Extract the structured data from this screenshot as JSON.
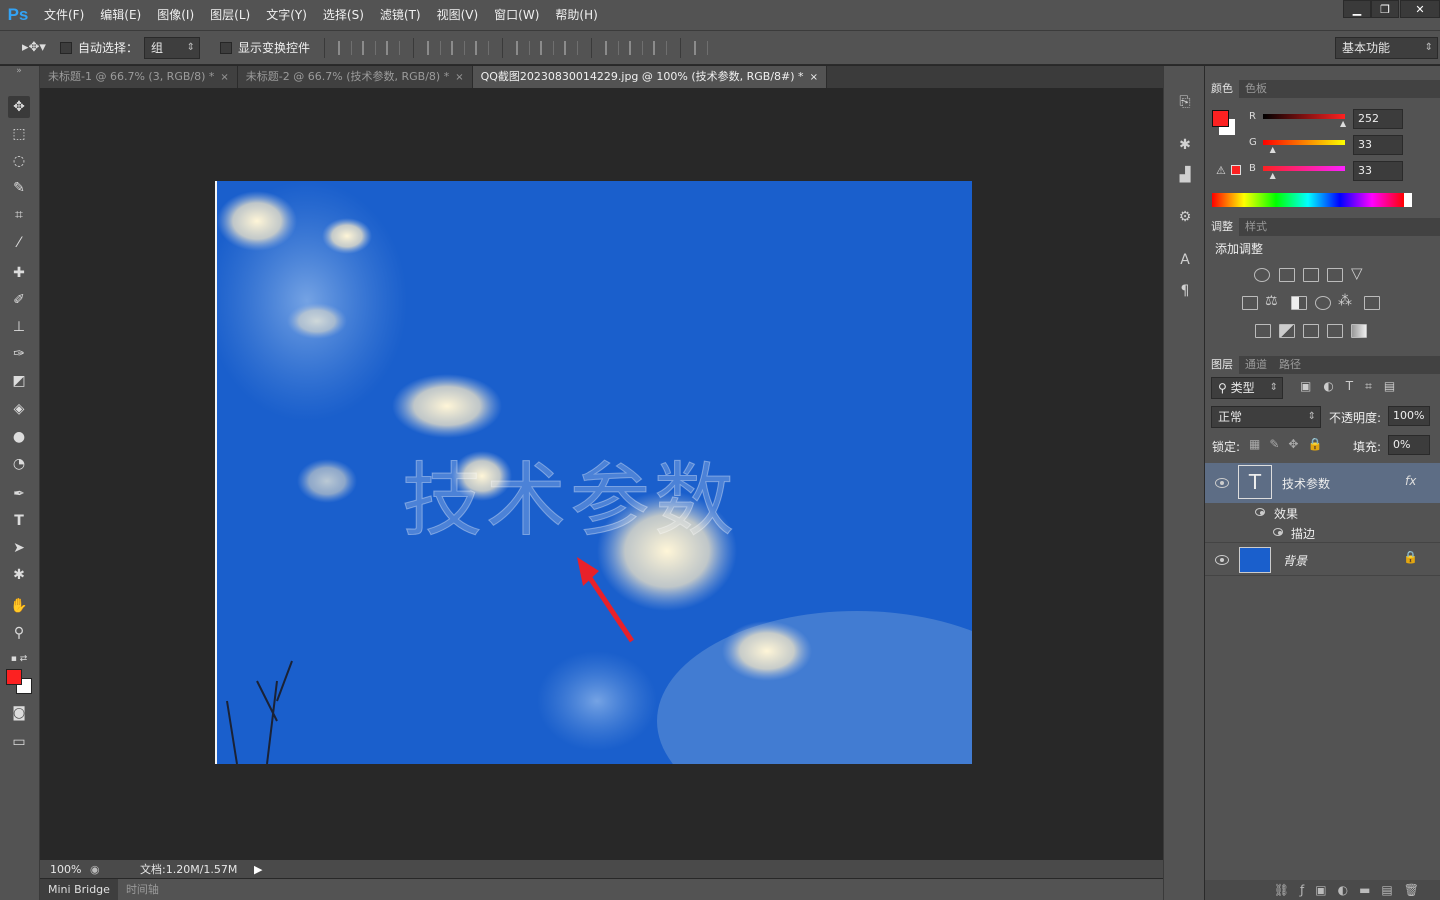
{
  "app": {
    "logo": "Ps"
  },
  "menu": [
    "文件(F)",
    "编辑(E)",
    "图像(I)",
    "图层(L)",
    "文字(Y)",
    "选择(S)",
    "滤镜(T)",
    "视图(V)",
    "窗口(W)",
    "帮助(H)"
  ],
  "window_controls": {
    "minimize": "▁",
    "restore": "❐",
    "close": "✕"
  },
  "options": {
    "auto_select_label": "自动选择：",
    "auto_select_value": "组",
    "show_transform_label": "显示变换控件",
    "workspace": "基本功能"
  },
  "doc_tabs": [
    {
      "label": "未标题-1 @ 66.7% (3, RGB/8) *",
      "active": false
    },
    {
      "label": "未标题-2 @ 66.7% (技术参数, RGB/8) *",
      "active": false
    },
    {
      "label": "QQ截图20230830014229.jpg @ 100% (技术参数, RGB/8#) *",
      "active": true
    }
  ],
  "canvas": {
    "watermark_text": "技术参数",
    "arrow_color": "#e8212a"
  },
  "status": {
    "zoom": "100%",
    "doc_size": "文档:1.20M/1.57M"
  },
  "bottom_tabs": [
    "Mini Bridge",
    "时间轴"
  ],
  "color_panel": {
    "tabs": [
      "颜色",
      "色板"
    ],
    "foreground": "#fc2121",
    "background": "#ffffff",
    "r_label": "R",
    "r": "252",
    "g_label": "G",
    "g": "33",
    "b_label": "B",
    "b": "33",
    "r_level": 0.988,
    "g_level": 0.129,
    "b_level": 0.129
  },
  "adjust_panel": {
    "tabs": [
      "调整",
      "样式"
    ],
    "title": "添加调整"
  },
  "layers_panel": {
    "tabs": [
      "图层",
      "通道",
      "路径"
    ],
    "filter_label": "类型",
    "blend_mode": "正常",
    "opacity_label": "不透明度:",
    "opacity": "100%",
    "lock_label": "锁定:",
    "fill_label": "填充:",
    "fill": "0%",
    "layers": [
      {
        "name": "技术参数",
        "fx": "fx",
        "kind": "text"
      },
      {
        "name": "效果",
        "kind": "effect-group"
      },
      {
        "name": "描边",
        "kind": "effect"
      },
      {
        "name": "背景",
        "kind": "image"
      }
    ]
  }
}
